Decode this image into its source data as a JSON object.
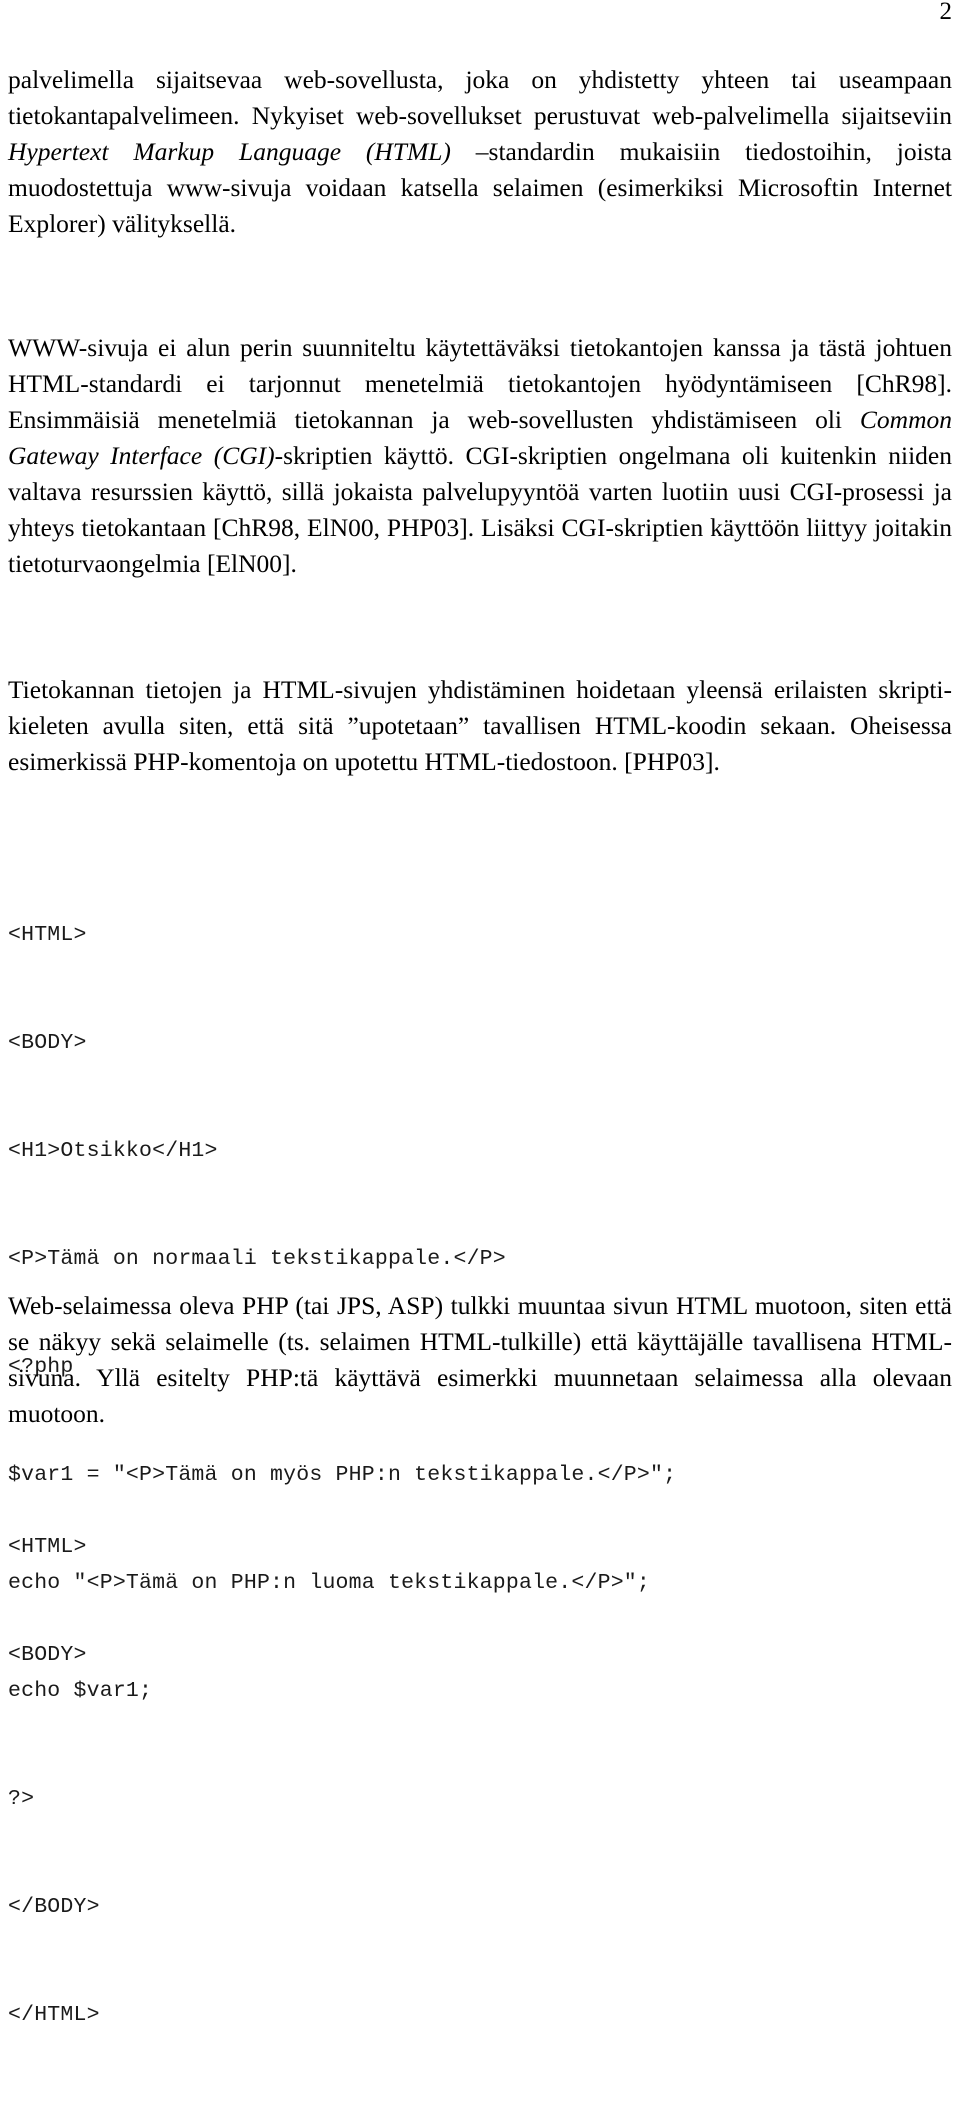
{
  "page": {
    "number": "2"
  },
  "paragraphs": {
    "p1": {
      "seg1": "palvelimella sijaitsevaa web-sovellusta, joka on yhdistetty yhteen tai useampaan tietokantapalvelimeen. Nykyiset web-sovellukset perustuvat web-palvelimella sijaitseviin ",
      "em1": "Hypertext Markup Language (HTML)",
      "seg2": " –standardin mukaisiin tiedostoihin, joista muodostettuja www-sivuja voidaan katsella selaimen (esimerkiksi Microsoftin Internet Explorer) välityksellä."
    },
    "p2": {
      "seg1": "WWW-sivuja ei alun perin suunniteltu käytettäväksi tietokantojen kanssa ja tästä johtuen HTML-standardi ei tarjonnut menetelmiä tietokantojen hyödyntämiseen [ChR98]. Ensimmäisiä menetelmiä tietokannan ja web-sovellusten yhdistämiseen oli ",
      "em1": "Common Gateway Interface (CGI)",
      "seg2": "-skriptien käyttö. CGI-skriptien ongelmana oli kuitenkin niiden valtava resurssien käyttö, sillä jokaista palvelupyyntöä varten luotiin uusi CGI-prosessi ja yhteys tietokantaan [ChR98, ElN00, PHP03]. Lisäksi CGI-skriptien käyttöön liittyy joitakin tietoturvaongelmia [ElN00]."
    },
    "p3": {
      "text": "Tietokannan tietojen ja HTML-sivujen yhdistäminen hoidetaan yleensä erilaisten skripti-kieleten avulla siten, että sitä ”upotetaan” tavallisen HTML-koodin sekaan. Oheisessa esimerkissä PHP-komentoja on upotettu HTML-tiedostoon. [PHP03]."
    },
    "p4": {
      "text": "Web-selaimessa oleva PHP (tai JPS, ASP) tulkki muuntaa sivun HTML muotoon, siten että se näkyy sekä selaimelle (ts. selaimen HTML-tulkille) että käyttäjälle tavallisena HTML-sivuna. Yllä esitelty PHP:tä käyttävä esimerkki muunnetaan selaimessa alla olevaan muotoon."
    }
  },
  "code_block_1": {
    "lines": [
      "<HTML>",
      "<BODY>",
      "<H1>Otsikko</H1>",
      "<P>Tämä on normaali tekstikappale.</P>",
      "<?php",
      "$var1 = \"<P>Tämä on myös PHP:n tekstikappale.</P>\";",
      "echo \"<P>Tämä on PHP:n luoma tekstikappale.</P>\";",
      "echo $var1;",
      "?>",
      "</BODY>",
      "</HTML>"
    ]
  },
  "code_block_2": {
    "lines": [
      "<HTML>",
      "<BODY>"
    ]
  },
  "colors": {
    "page_background": "#ffffff",
    "body_text": "#000000",
    "code_text": "#1a1a1a"
  }
}
